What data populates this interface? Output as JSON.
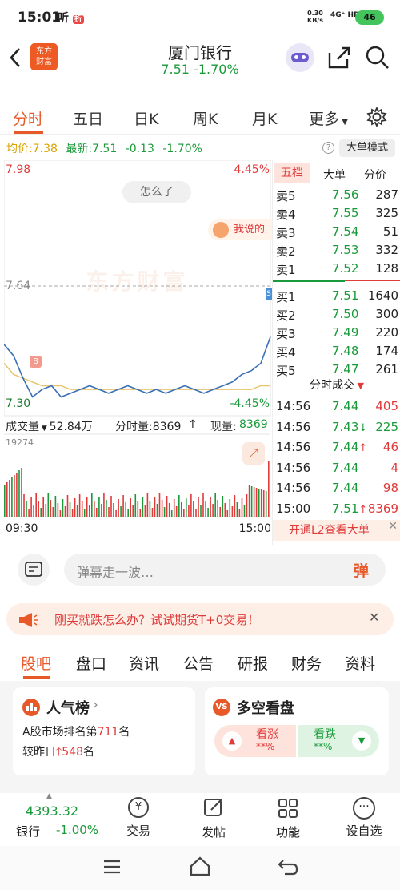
{
  "status_bar": {
    "time": "15:01",
    "net_speed": "0.30",
    "net_unit": "KB/s",
    "signal": "4G⁺ HD",
    "battery": "46"
  },
  "header": {
    "logo_line1": "东方",
    "logo_line2": "财富",
    "stock_name": "厦门银行",
    "price_change": "7.51  -1.70%"
  },
  "ticker": "",
  "chart_tabs": [
    "分时",
    "五日",
    "日K",
    "周K",
    "月K",
    "更多"
  ],
  "quote_line": {
    "avg_label": "均价:",
    "avg": "7.38",
    "latest_label": "最新:",
    "latest": "7.51",
    "change": "-0.13",
    "pct": "-1.70%",
    "mode_button": "大单模式"
  },
  "chart": {
    "y_high": "7.98",
    "pct_high": "4.45%",
    "y_mid": "7.64",
    "y_low": "7.30",
    "pct_low": "-4.45%",
    "watermark": "东方财富",
    "bubble": "怎么了",
    "comment_label": "我说的",
    "b_marker": "B",
    "s_marker": "S",
    "vol_label": "成交量",
    "vol_total": "52.84万",
    "minute_vol": "分时量:8369",
    "current_vol": "现量:8369",
    "vol_max": "19274",
    "time_start": "09:30",
    "time_end": "15:00"
  },
  "chart_data": {
    "type": "line",
    "x_range": [
      "09:30",
      "15:00"
    ],
    "ylim": [
      7.3,
      7.98
    ],
    "series": [
      {
        "values": [
          7.49,
          7.46,
          7.4,
          7.35,
          7.37,
          7.38,
          7.35,
          7.36,
          7.37,
          7.38,
          7.37,
          7.36,
          7.37,
          7.38,
          7.37,
          7.36,
          7.37,
          7.36,
          7.37,
          7.38,
          7.37,
          7.36,
          7.37,
          7.38,
          7.39,
          7.41,
          7.42,
          7.44,
          7.51
        ]
      },
      {
        "values": [
          7.44,
          7.41,
          7.4,
          7.39,
          7.38,
          7.38,
          7.38,
          7.37,
          7.37,
          7.37,
          7.37,
          7.37,
          7.37,
          7.37,
          7.37,
          7.37,
          7.37,
          7.37,
          7.37,
          7.37,
          7.37,
          7.37,
          7.37,
          7.37,
          7.37,
          7.37,
          7.37,
          7.38,
          7.38
        ]
      }
    ]
  },
  "order_book": {
    "tabs": [
      "五档",
      "大单",
      "分价"
    ],
    "sell": [
      {
        "label": "卖5",
        "price": "7.56",
        "vol": "287"
      },
      {
        "label": "卖4",
        "price": "7.55",
        "vol": "325"
      },
      {
        "label": "卖3",
        "price": "7.54",
        "vol": "51"
      },
      {
        "label": "卖2",
        "price": "7.53",
        "vol": "332"
      },
      {
        "label": "卖1",
        "price": "7.52",
        "vol": "128"
      }
    ],
    "buy": [
      {
        "label": "买1",
        "price": "7.51",
        "vol": "1640"
      },
      {
        "label": "买2",
        "price": "7.50",
        "vol": "300"
      },
      {
        "label": "买3",
        "price": "7.49",
        "vol": "220"
      },
      {
        "label": "买4",
        "price": "7.48",
        "vol": "174"
      },
      {
        "label": "买5",
        "price": "7.47",
        "vol": "261"
      }
    ],
    "trades_title": "分时成交",
    "trades": [
      {
        "time": "14:56",
        "price": "7.44",
        "vol": "405",
        "arrow": ""
      },
      {
        "time": "14:56",
        "price": "7.43",
        "vol": "225",
        "arrow": "↓"
      },
      {
        "time": "14:56",
        "price": "7.44",
        "vol": "46",
        "arrow": "↑"
      },
      {
        "time": "14:56",
        "price": "7.44",
        "vol": "4",
        "arrow": ""
      },
      {
        "time": "14:56",
        "price": "7.44",
        "vol": "98",
        "arrow": ""
      },
      {
        "time": "15:00",
        "price": "7.51",
        "vol": "8369",
        "arrow": "↑"
      }
    ],
    "l2_promo": "开通L2查看大单"
  },
  "danmaku": {
    "placeholder": "弹幕走一波…",
    "button": "弹"
  },
  "promo": {
    "text": "刚买就跌怎么办？试试期货T+0交易！"
  },
  "bottom_tabs": [
    "股吧",
    "盘口",
    "资讯",
    "公告",
    "研报",
    "财务",
    "资料"
  ],
  "cards": {
    "popularity": {
      "title": "人气榜",
      "line1_prefix": "A股市场排名第",
      "rank": "711",
      "line1_suffix": "名",
      "line2_prefix": "较昨日",
      "change": "548",
      "line2_suffix": "名"
    },
    "bullbear": {
      "title": "多空看盘",
      "bull": "看涨",
      "bull_pct": "**%",
      "bear": "看跌",
      "bear_pct": "**%"
    }
  },
  "nav": {
    "index_value": "4393.32",
    "index_name": "银行",
    "index_pct": "-1.00%",
    "items": [
      "交易",
      "发帖",
      "功能",
      "设自选"
    ]
  }
}
